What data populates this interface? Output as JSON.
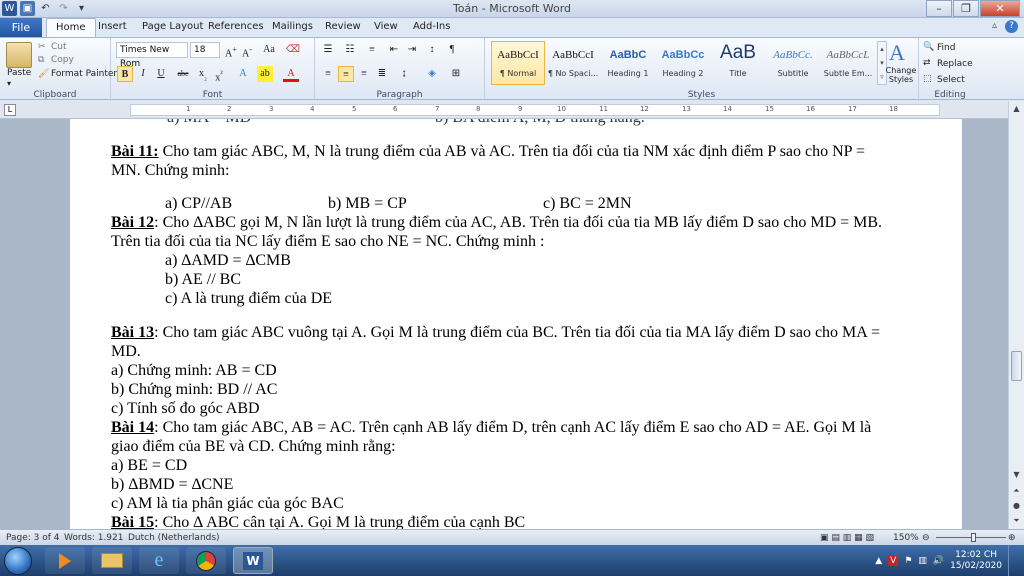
{
  "window": {
    "title": "Toán - Microsoft Word"
  },
  "tabs": {
    "file": "File",
    "home": "Home",
    "insert": "Insert",
    "page_layout": "Page Layout",
    "references": "References",
    "mailings": "Mailings",
    "review": "Review",
    "view": "View",
    "addins": "Add-Ins"
  },
  "ribbon": {
    "clipboard": {
      "paste": "Paste",
      "cut": "Cut",
      "copy": "Copy",
      "format_painter": "Format Painter",
      "label": "Clipboard"
    },
    "font": {
      "name": "Times New Rom",
      "size": "18",
      "label": "Font"
    },
    "paragraph": {
      "label": "Paragraph"
    },
    "styles": {
      "label": "Styles",
      "items": [
        {
          "preview": "AaBbCcI",
          "name": "¶ Normal"
        },
        {
          "preview": "AaBbCcI",
          "name": "¶ No Spaci..."
        },
        {
          "preview": "AaBbC",
          "name": "Heading 1"
        },
        {
          "preview": "AaBbCc",
          "name": "Heading 2"
        },
        {
          "preview": "AaB",
          "name": "Title"
        },
        {
          "preview": "AaBbCc.",
          "name": "Subtitle"
        },
        {
          "preview": "AaBbCcL",
          "name": "Subtle Em..."
        }
      ],
      "change_styles": "Change Styles"
    },
    "editing": {
      "find": "Find",
      "replace": "Replace",
      "select": "Select",
      "label": "Editing"
    }
  },
  "ruler": {
    "numbers": [
      "1",
      "2",
      "3",
      "4",
      "5",
      "6",
      "7",
      "8",
      "9",
      "10",
      "11",
      "12",
      "13",
      "14",
      "15",
      "16",
      "17",
      "18"
    ]
  },
  "document": {
    "top_cut_left": "a) MA = MD",
    "top_cut_right": "b) BA điểm A, M, D thẳng hàng.",
    "b11_title": "Bài 11:",
    "b11_l1": " Cho tam giác ABC, M, N là trung điểm của AB và AC. Trên tia đối của tia NM xác định điểm P sao cho NP =",
    "b11_l2": "MN. Chứng minh:",
    "b11_a": "a)    CP//AB",
    "b11_b": "b) MB = CP",
    "b11_c": "c) BC = 2MN",
    "b12_title": "Bài 12",
    "b12_l1": ": Cho ∆ABC gọi M, N lần lượt là trung điểm của AC, AB.  Trên tia đối của tia MB lấy điểm D sao cho MD = MB.",
    "b12_l2": "Trên tia đối của tia NC lấy điểm E sao cho NE = NC. Chứng minh :",
    "b12_a": "a)  ∆AMD = ∆CMB",
    "b12_b": "b)  AE // BC",
    "b12_c": "c)  A là trung điểm của DE",
    "b13_title": "Bài 13",
    "b13_l1": ": Cho tam giác ABC vuông tại A. Gọi M là trung điểm của BC. Trên tia đối của tia MA lấy điểm D sao cho MA =",
    "b13_l2": "MD.",
    "b13_a": "a)  Chứng minh: AB = CD",
    "b13_b": "b)  Chứng minh: BD // AC",
    "b13_c": "c)  Tính số đo góc ABD",
    "b14_title": "Bài 14",
    "b14_l1": ": Cho tam giác ABC, AB = AC. Trên cạnh AB lấy điểm D, trên cạnh AC lấy điểm E sao cho AD = AE. Gọi M là",
    "b14_l2": "giao điểm của BE và CD. Chứng minh rằng:",
    "b14_a": "a)  BE = CD",
    "b14_b": "b)  ∆BMD = ∆CNE",
    "b14_c": "c)  AM là tia phân giác của góc BAC",
    "b15_title": "Bài 15",
    "b15_l1": ": Cho ∆ ABC cân tại A. Gọi M là trung điểm của cạnh BC"
  },
  "status": {
    "page": "Page: 3 of 4",
    "words": "Words: 1.921",
    "language": "Dutch (Netherlands)",
    "zoom": "150%"
  },
  "clock": {
    "time": "12:02 CH",
    "date": "15/02/2020"
  },
  "colors": {
    "file_tab": "#2a5ea8",
    "accent": "#e5b844",
    "taskbar": "#2a548a"
  }
}
